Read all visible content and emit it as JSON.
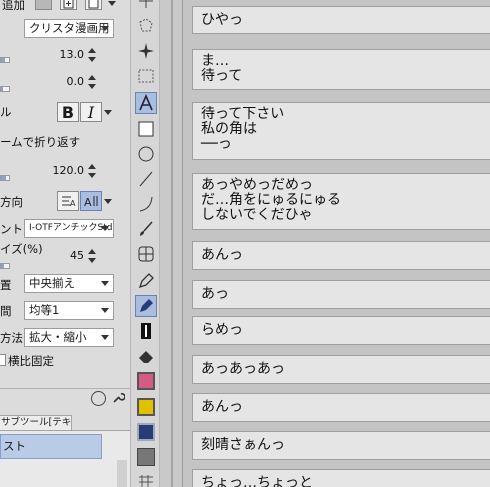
{
  "property_panel": {
    "top_label": "追加",
    "font_style_preset": "クリスタ漫画用",
    "values": {
      "first": "13.0",
      "second": "0.0",
      "third": "120.0",
      "fourth": "45"
    },
    "font_section_label": "ル",
    "bold_label": "B",
    "italic_label": "I",
    "wrap_label": "ームで折り返す",
    "direction_label": "方向",
    "font_label": "ント",
    "font_value": "I-OTFアンチックStd",
    "size_label": "イズ(%)",
    "align_label": "置",
    "align_value": "中央揃え",
    "spacing_label": "間",
    "spacing_value": "均等1",
    "method_label": "方法",
    "method_value": "拡大・縮小",
    "fixed_label": "横比固定",
    "subtool_tab": "サブツール[テキスト]",
    "subtool_item": "スト"
  },
  "text_list": {
    "entries": [
      "ひやっ",
      "ま…\n待って",
      "待って下さい\n私の角は\n──っ",
      "あっやめっだめっ\nだ…角をにゅるにゅる\nしないでくだひゃ",
      "あんっ",
      "あっ",
      "らめっ",
      "あっあっあっ",
      "あんっ",
      "刻晴さぁんっ",
      "ちょっ…ちょっと"
    ]
  },
  "colors": {
    "panel_bg": "#dcdcdc",
    "toolbar_bg": "#d6d6d6",
    "list_bg": "#c4c4c4",
    "entry_bg": "#e5e5e5",
    "accent": "#a9bddf",
    "main_color_swatch": "#d65a86",
    "sub_color_swatch": "#e0c000",
    "transparent_swatch": "#2a3a78"
  }
}
